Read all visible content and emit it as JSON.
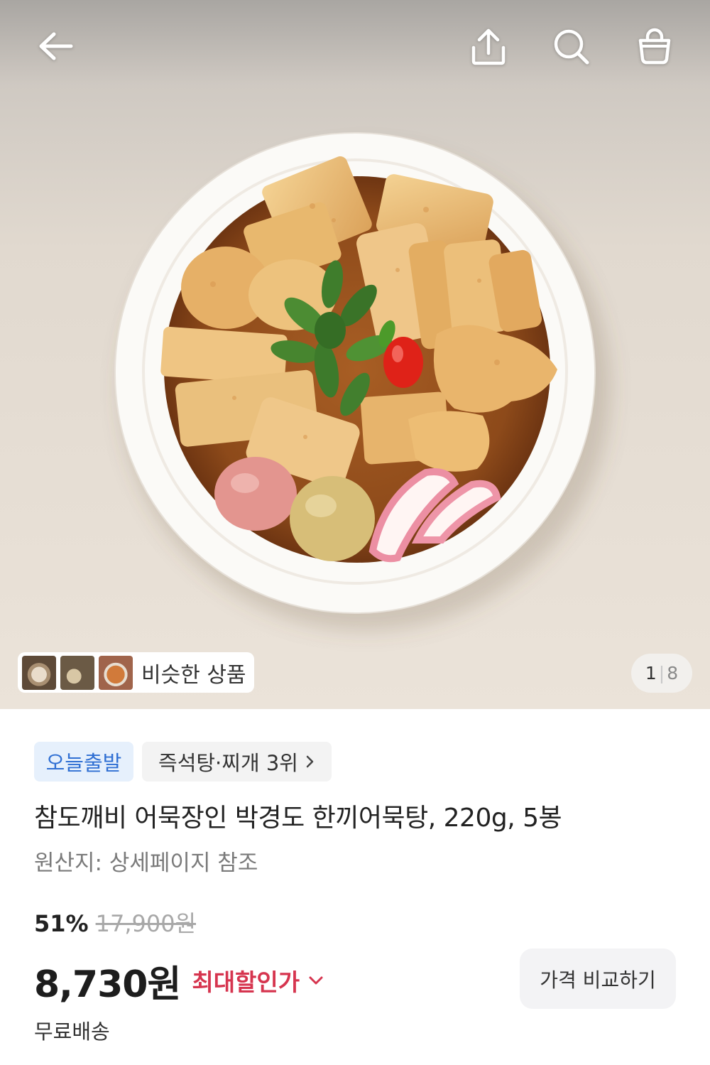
{
  "nav": {
    "back_icon": "arrow-left-icon",
    "share_icon": "share-icon",
    "search_icon": "search-icon",
    "cart_icon": "shopping-bag-icon"
  },
  "gallery": {
    "similar_label": "비슷한 상품",
    "current": "1",
    "separator": "|",
    "total": "8"
  },
  "tags": [
    {
      "label": "오늘출발"
    },
    {
      "label": "즉석탕·찌개 3위",
      "icon": "chevron-right-icon"
    }
  ],
  "product": {
    "title": "참도깨비 어묵장인 박경도 한끼어묵탕, 220g, 5봉",
    "origin": "원산지: 상세페이지 참조",
    "discount_rate": "51%",
    "original_price": "17,900원",
    "price": "8,730원",
    "max_discount_label": "최대할인가",
    "max_discount_icon": "chevron-down-icon",
    "compare_button": "가격 비교하기",
    "shipping": "무료배송"
  },
  "colors": {
    "discount_red": "#d6354f",
    "tag_blue": "#2f6fd3"
  }
}
